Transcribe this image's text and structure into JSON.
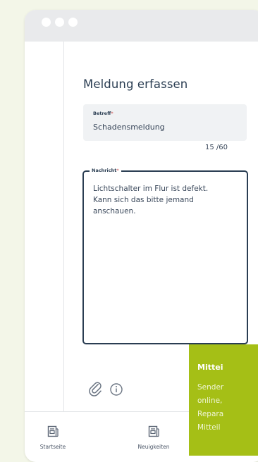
{
  "form": {
    "title": "Meldung erfassen",
    "subject": {
      "label": "Betreff",
      "required_mark": "*",
      "value": "Schadensmeldung",
      "counter": "15 /60"
    },
    "message": {
      "label": "Nachricht",
      "required_mark": "*",
      "value": "Lichtschalter im Flur ist defekt.\nKann sich das bitte jemand\nanschauen."
    }
  },
  "toolbar": {
    "attach_icon": "paperclip-icon",
    "info_icon": "info-icon"
  },
  "nav": {
    "items": [
      {
        "label": "Startseite",
        "icon": "home-document-icon"
      },
      {
        "label": "Neuigkeiten",
        "icon": "news-icon"
      }
    ]
  },
  "toast": {
    "title": "Mittei",
    "lines": [
      "Sender",
      "online,",
      "Repara",
      "Mitteil"
    ]
  },
  "colors": {
    "accent": "#a5bf16",
    "text": "#2a3d52",
    "field_bg": "#f0f2f4",
    "page_bg": "#f3f6e8"
  }
}
